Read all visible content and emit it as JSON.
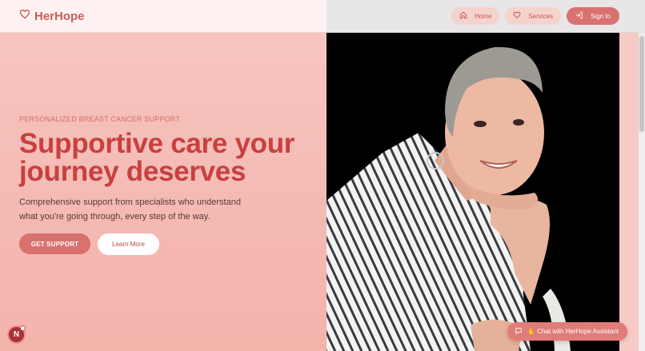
{
  "header": {
    "brand": "HerHope",
    "nav": [
      {
        "label": "Home",
        "icon": "home-icon"
      },
      {
        "label": "Services",
        "icon": "heart-icon"
      },
      {
        "label": "Sign In",
        "icon": "sign-in-icon"
      }
    ]
  },
  "hero": {
    "eyebrow": "PERSONALIZED BREAST CANCER SUPPORT",
    "headline": "Supportive care your journey deserves",
    "subtext": "Comprehensive support from specialists who understand what you're going through, every step of the way.",
    "primary_cta": "GET SUPPORT",
    "secondary_cta": "Learn More"
  },
  "badge": {
    "letter": "N"
  },
  "chat": {
    "label": "✋ Chat with HerHope Assistant"
  },
  "colors": {
    "brand": "#cf5b59",
    "headline": "#c8403f",
    "button": "#d9716f",
    "hero_bg": "#f6c3bd"
  }
}
